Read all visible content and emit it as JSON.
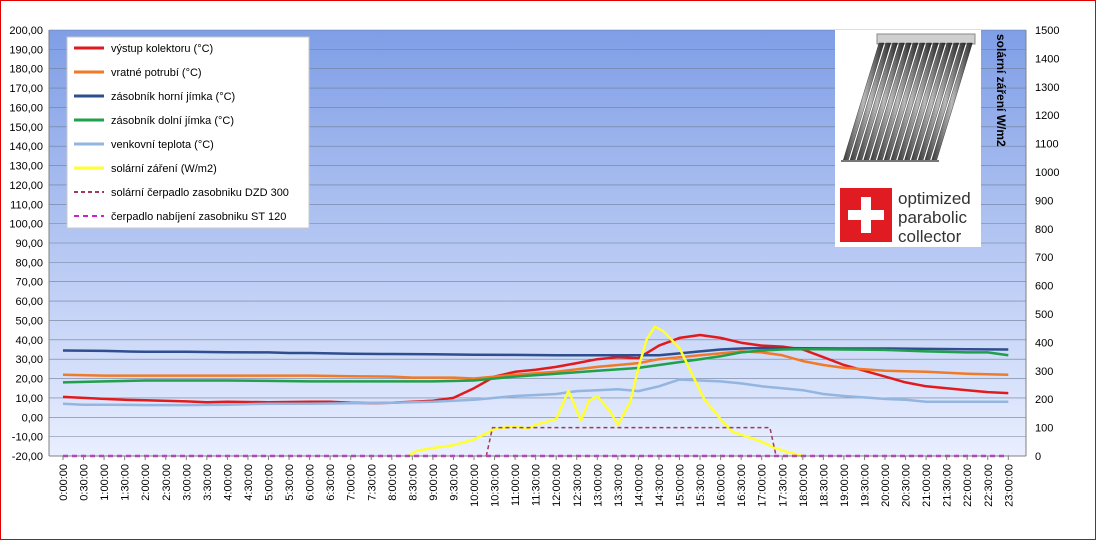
{
  "chart_data": {
    "type": "line",
    "title": "",
    "xlabel": "",
    "ylabel": "",
    "y2label": "solární záření W/m2",
    "ylim": [
      -20,
      200
    ],
    "y2lim": [
      0,
      1500
    ],
    "grid": true,
    "legend_position": "top-left",
    "x_tick_labels": [
      "0:00:00",
      "0:30:00",
      "1:00:00",
      "1:30:00",
      "2:00:00",
      "2:30:00",
      "3:00:00",
      "3:30:00",
      "4:00:00",
      "4:30:00",
      "5:00:00",
      "5:30:00",
      "6:00:00",
      "6:30:00",
      "7:00:00",
      "7:30:00",
      "8:00:00",
      "8:30:00",
      "9:00:00",
      "9:30:00",
      "10:00:00",
      "10:30:00",
      "11:00:00",
      "11:30:00",
      "12:00:00",
      "12:30:00",
      "13:00:00",
      "13:30:00",
      "14:00:00",
      "14:30:00",
      "15:00:00",
      "15:30:00",
      "16:00:00",
      "16:30:00",
      "17:00:00",
      "17:30:00",
      "18:00:00",
      "18:30:00",
      "19:00:00",
      "19:30:00",
      "20:00:00",
      "20:30:00",
      "21:00:00",
      "21:30:00",
      "22:00:00",
      "22:30:00",
      "23:00:00"
    ],
    "y_tick_labels": [
      "200,00",
      "190,00",
      "180,00",
      "170,00",
      "160,00",
      "150,00",
      "140,00",
      "130,00",
      "120,00",
      "110,00",
      "100,00",
      "90,00",
      "80,00",
      "70,00",
      "60,00",
      "50,00",
      "40,00",
      "30,00",
      "20,00",
      "10,00",
      "0,00",
      "-10,00",
      "-20,00"
    ],
    "y2_tick_labels": [
      "1500",
      "1400",
      "1300",
      "1200",
      "1100",
      "1000",
      "900",
      "800",
      "700",
      "600",
      "500",
      "400",
      "300",
      "200",
      "100",
      "0"
    ],
    "series": [
      {
        "name": "výstup kolektoru (°C)",
        "color": "#e31a1c",
        "axis": "left",
        "dash": "",
        "width": 2.5,
        "points": [
          [
            0,
            10.5
          ],
          [
            0.5,
            10
          ],
          [
            1,
            9.5
          ],
          [
            1.5,
            9
          ],
          [
            2,
            8.8
          ],
          [
            3,
            8.2
          ],
          [
            3.5,
            7.8
          ],
          [
            4,
            8
          ],
          [
            5,
            7.8
          ],
          [
            6,
            8
          ],
          [
            6.5,
            8
          ],
          [
            7,
            7.5
          ],
          [
            7.5,
            7.3
          ],
          [
            8,
            7.5
          ],
          [
            8.5,
            8
          ],
          [
            9,
            8.5
          ],
          [
            9.5,
            10
          ],
          [
            10,
            15
          ],
          [
            10.5,
            21
          ],
          [
            11,
            23.5
          ],
          [
            11.5,
            24.5
          ],
          [
            12,
            26
          ],
          [
            12.5,
            28
          ],
          [
            13,
            30
          ],
          [
            13.5,
            31
          ],
          [
            14,
            30.5
          ],
          [
            14.5,
            37
          ],
          [
            15,
            41
          ],
          [
            15.5,
            42.5
          ],
          [
            16,
            41
          ],
          [
            16.5,
            38.5
          ],
          [
            17,
            37
          ],
          [
            17.5,
            36.5
          ],
          [
            18,
            35
          ],
          [
            18.5,
            31
          ],
          [
            19,
            27
          ],
          [
            19.5,
            24
          ],
          [
            20,
            21
          ],
          [
            20.5,
            18
          ],
          [
            21,
            16
          ],
          [
            21.5,
            15
          ],
          [
            22,
            14
          ],
          [
            22.5,
            13
          ],
          [
            23,
            12.5
          ]
        ]
      },
      {
        "name": "vratné potrubí (°C)",
        "color": "#f07a28",
        "axis": "left",
        "dash": "",
        "width": 2.5,
        "points": [
          [
            0,
            22
          ],
          [
            1,
            21.5
          ],
          [
            2,
            21.5
          ],
          [
            3,
            21.5
          ],
          [
            4,
            21.5
          ],
          [
            5,
            21.5
          ],
          [
            6,
            21.5
          ],
          [
            7,
            21.2
          ],
          [
            8,
            21
          ],
          [
            8.5,
            20.5
          ],
          [
            9,
            20.5
          ],
          [
            9.5,
            20.5
          ],
          [
            10,
            20
          ],
          [
            10.5,
            21
          ],
          [
            11,
            22
          ],
          [
            12,
            23.5
          ],
          [
            13,
            26
          ],
          [
            14,
            28
          ],
          [
            14.5,
            30
          ],
          [
            15,
            31
          ],
          [
            15.5,
            32
          ],
          [
            16,
            33
          ],
          [
            16.5,
            34
          ],
          [
            17,
            33.5
          ],
          [
            17.5,
            32
          ],
          [
            18,
            29
          ],
          [
            18.5,
            27
          ],
          [
            19,
            25.5
          ],
          [
            20,
            24
          ],
          [
            21,
            23.5
          ],
          [
            22,
            22.5
          ],
          [
            23,
            22
          ]
        ]
      },
      {
        "name": "zásobník horní jímka (°C)",
        "color": "#2e4e8e",
        "axis": "left",
        "dash": "",
        "width": 2.5,
        "points": [
          [
            0,
            34.5
          ],
          [
            1,
            34.3
          ],
          [
            1.5,
            34
          ],
          [
            2,
            33.8
          ],
          [
            3,
            33.8
          ],
          [
            4,
            33.6
          ],
          [
            5,
            33.5
          ],
          [
            5.5,
            33.2
          ],
          [
            6,
            33.2
          ],
          [
            7,
            32.8
          ],
          [
            8,
            32.7
          ],
          [
            9,
            32.5
          ],
          [
            10,
            32.3
          ],
          [
            11,
            32.2
          ],
          [
            12,
            32
          ],
          [
            13,
            32
          ],
          [
            14,
            32
          ],
          [
            14.5,
            32
          ],
          [
            15,
            33
          ],
          [
            15.5,
            34
          ],
          [
            16,
            35
          ],
          [
            16.5,
            35.5
          ],
          [
            17,
            35.8
          ],
          [
            18,
            35.6
          ],
          [
            19,
            35.5
          ],
          [
            20,
            35.5
          ],
          [
            21,
            35.3
          ],
          [
            22,
            35.1
          ],
          [
            23,
            35
          ]
        ]
      },
      {
        "name": "zásobník dolní jímka  (°C)",
        "color": "#1fa04a",
        "axis": "left",
        "dash": "",
        "width": 2.5,
        "points": [
          [
            0,
            18
          ],
          [
            1,
            18.5
          ],
          [
            2,
            19
          ],
          [
            3,
            19
          ],
          [
            4,
            19
          ],
          [
            5,
            18.8
          ],
          [
            6,
            18.5
          ],
          [
            7,
            18.5
          ],
          [
            8,
            18.5
          ],
          [
            9,
            18.5
          ],
          [
            10,
            19
          ],
          [
            10.5,
            20
          ],
          [
            11,
            21
          ],
          [
            12,
            22.5
          ],
          [
            13,
            24
          ],
          [
            14,
            25.5
          ],
          [
            14.5,
            27
          ],
          [
            15,
            28.5
          ],
          [
            15.5,
            30
          ],
          [
            16,
            31.5
          ],
          [
            16.5,
            33.5
          ],
          [
            17,
            34.5
          ],
          [
            17.5,
            35
          ],
          [
            18,
            35.2
          ],
          [
            19,
            35
          ],
          [
            20,
            34.8
          ],
          [
            21,
            34
          ],
          [
            22,
            33.5
          ],
          [
            22.5,
            33.5
          ],
          [
            23,
            32
          ]
        ]
      },
      {
        "name": "venkovní teplota (°C)",
        "color": "#93b5e0",
        "axis": "left",
        "dash": "",
        "width": 2.5,
        "points": [
          [
            0,
            7
          ],
          [
            0.5,
            6.5
          ],
          [
            1,
            6.5
          ],
          [
            2,
            6.3
          ],
          [
            3,
            6.3
          ],
          [
            4,
            6.5
          ],
          [
            5,
            7
          ],
          [
            6,
            7
          ],
          [
            7,
            7.2
          ],
          [
            8,
            7.5
          ],
          [
            9,
            8
          ],
          [
            9.5,
            8.5
          ],
          [
            10,
            9
          ],
          [
            10.5,
            10
          ],
          [
            11,
            11
          ],
          [
            12,
            12
          ],
          [
            12.5,
            13.5
          ],
          [
            13,
            14
          ],
          [
            13.5,
            14.5
          ],
          [
            14,
            13.5
          ],
          [
            14.5,
            16
          ],
          [
            15,
            19.5
          ],
          [
            15.5,
            19
          ],
          [
            16,
            18.5
          ],
          [
            16.5,
            17.5
          ],
          [
            17,
            16
          ],
          [
            17.5,
            15
          ],
          [
            18,
            14
          ],
          [
            18.5,
            12
          ],
          [
            19,
            11
          ],
          [
            20,
            9.5
          ],
          [
            20.5,
            9
          ],
          [
            21,
            8
          ],
          [
            21.5,
            8
          ],
          [
            22,
            8
          ],
          [
            23,
            8
          ]
        ]
      },
      {
        "name": "solární záření (W/m2)",
        "color": "#ffff33",
        "axis": "right",
        "dash": "",
        "width": 2.5,
        "points": [
          [
            8.4,
            0
          ],
          [
            8.6,
            18
          ],
          [
            9,
            28
          ],
          [
            9.5,
            38
          ],
          [
            10,
            58
          ],
          [
            10.5,
            95
          ],
          [
            11,
            105
          ],
          [
            11.3,
            95
          ],
          [
            11.5,
            110
          ],
          [
            12,
            130
          ],
          [
            12.3,
            230
          ],
          [
            12.6,
            125
          ],
          [
            12.8,
            195
          ],
          [
            13,
            210
          ],
          [
            13.3,
            160
          ],
          [
            13.5,
            110
          ],
          [
            13.8,
            190
          ],
          [
            14,
            310
          ],
          [
            14.2,
            410
          ],
          [
            14.4,
            455
          ],
          [
            14.6,
            440
          ],
          [
            15,
            380
          ],
          [
            15.3,
            290
          ],
          [
            15.6,
            200
          ],
          [
            16,
            130
          ],
          [
            16.3,
            85
          ],
          [
            16.7,
            65
          ],
          [
            17,
            50
          ],
          [
            17.3,
            30
          ],
          [
            17.6,
            15
          ],
          [
            18,
            0
          ]
        ]
      },
      {
        "name": "solární čerpadlo zasobniku  DZD 300",
        "color": "#a0395a",
        "axis": "right",
        "dash": "4,3",
        "width": 1.5,
        "points": [
          [
            10.3,
            0
          ],
          [
            10.45,
            100
          ],
          [
            17.2,
            100
          ],
          [
            17.35,
            0
          ]
        ]
      },
      {
        "name": "čerpadlo nabíjení  zasobniku ST 120",
        "color": "#cc22cc",
        "axis": "right",
        "dash": "5,4",
        "width": 2.5,
        "points": [
          [
            0,
            0
          ],
          [
            23,
            0
          ]
        ]
      }
    ]
  },
  "logo": {
    "line1": "optimized",
    "line2": "parabolic",
    "line3": "collector"
  }
}
